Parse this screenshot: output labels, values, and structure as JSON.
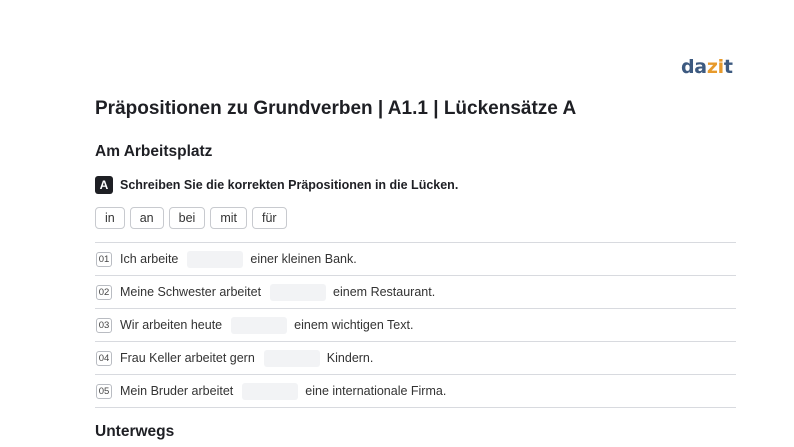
{
  "logo": {
    "part1": "da",
    "part2": "zi",
    "part3": "t"
  },
  "title": "Präpositionen zu Grundverben | A1.1 | Lückensätze A",
  "section1": "Am Arbeitsplatz",
  "instruction": {
    "badge": "A",
    "text": "Schreiben Sie die korrekten Präpositionen in die Lücken."
  },
  "word_bank": [
    "in",
    "an",
    "bei",
    "mit",
    "für"
  ],
  "rows": [
    {
      "num": "01",
      "before": "Ich arbeite",
      "after": "einer kleinen Bank."
    },
    {
      "num": "02",
      "before": "Meine Schwester arbeitet",
      "after": "einem Restaurant."
    },
    {
      "num": "03",
      "before": "Wir arbeiten heute",
      "after": "einem wichtigen Text."
    },
    {
      "num": "04",
      "before": "Frau Keller arbeitet gern",
      "after": "Kindern."
    },
    {
      "num": "05",
      "before": "Mein Bruder arbeitet",
      "after": "eine internationale Firma."
    }
  ],
  "section2": "Unterwegs",
  "colors": {
    "logo_blue": "#3d5a80",
    "logo_orange": "#e79a2c",
    "text": "#1e1f24",
    "gap_fill": "#f2f3f5"
  }
}
